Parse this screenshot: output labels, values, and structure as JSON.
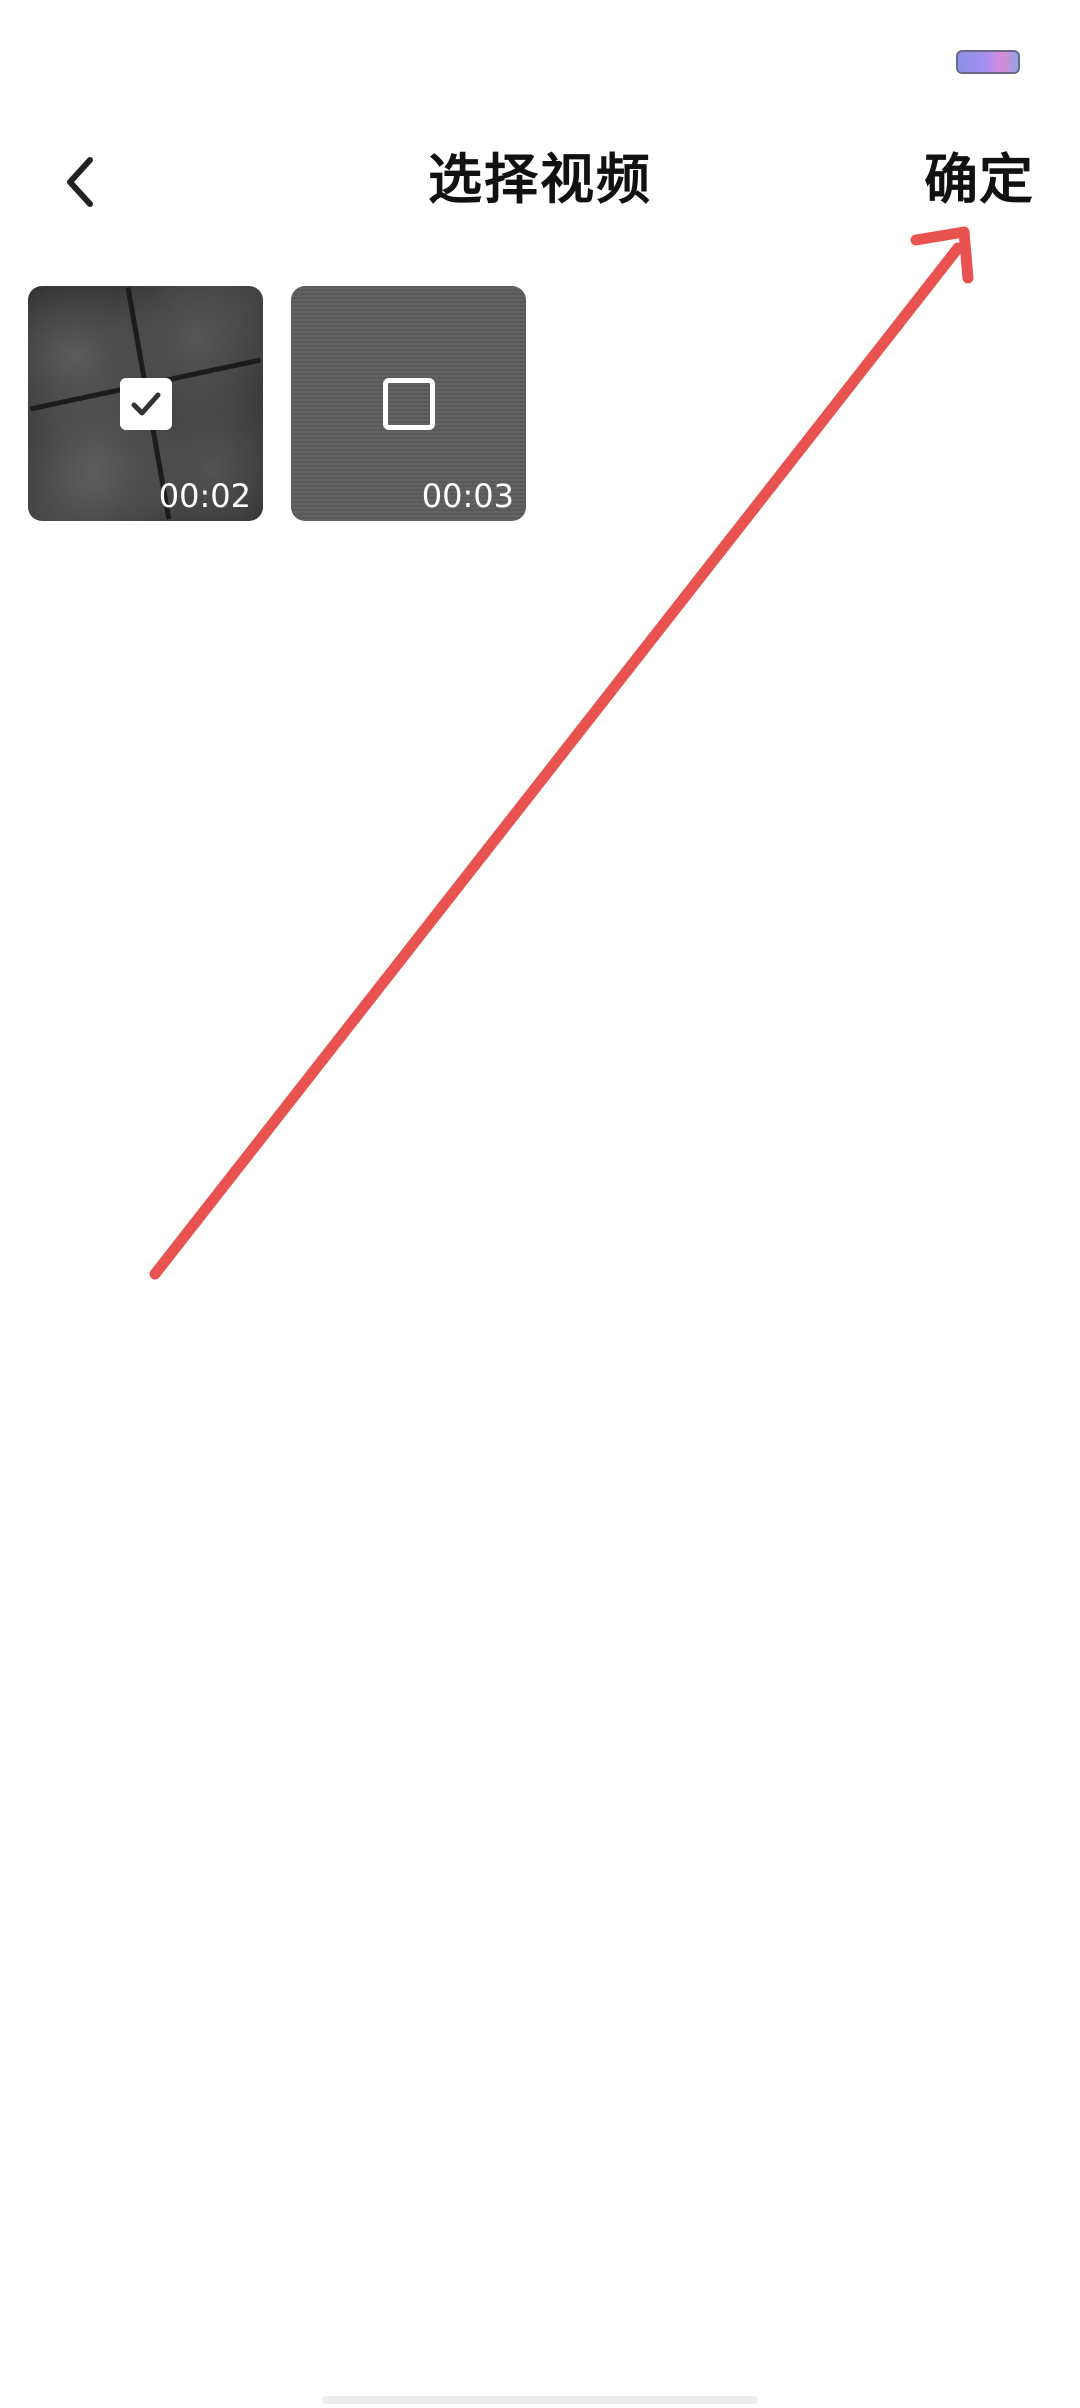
{
  "header": {
    "title": "选择视频",
    "confirm_label": "确定"
  },
  "videos": [
    {
      "duration": "00:02",
      "selected": true
    },
    {
      "duration": "00:03",
      "selected": false
    }
  ],
  "colors": {
    "annotation_arrow": "#e8524f",
    "text": "#111111",
    "background": "#ffffff"
  },
  "icons": {
    "back": "chevron-left-icon",
    "checked": "checkbox-checked-icon",
    "unchecked": "checkbox-unchecked-icon"
  }
}
